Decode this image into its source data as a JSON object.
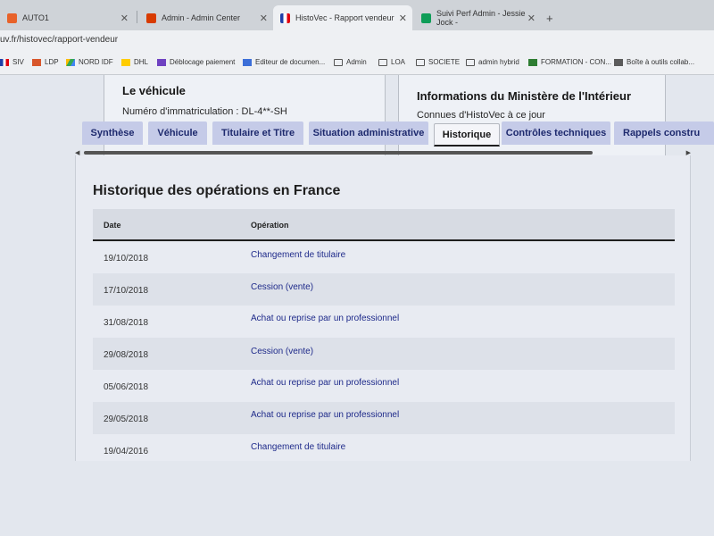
{
  "browser": {
    "tabs": [
      {
        "title": "AUTO1",
        "favicon_color": "#e8622a",
        "active": false
      },
      {
        "title": "Admin - Admin Center",
        "favicon_color": "#d83b01",
        "active": false
      },
      {
        "title": "HistoVec - Rapport vendeur",
        "favicon_color": "#3a4db0",
        "active": true
      },
      {
        "title": "Suivi Perf Admin - Jessie Jock -",
        "favicon_color": "#0f9d58",
        "active": false
      }
    ],
    "new_tab": "+",
    "url": "uv.fr/histovec/rapport-vendeur"
  },
  "bookmarks": [
    {
      "label": "SIV",
      "icon": "flag-icon"
    },
    {
      "label": "LDP",
      "icon": "app-icon"
    },
    {
      "label": "NORD IDF",
      "icon": "drive-icon"
    },
    {
      "label": "DHL",
      "icon": "dhl-icon"
    },
    {
      "label": "Déblocage paiement",
      "icon": "app-icon"
    },
    {
      "label": "Editeur de documen...",
      "icon": "doc-icon"
    },
    {
      "label": "Admin",
      "icon": "folder-icon"
    },
    {
      "label": "LOA",
      "icon": "folder-icon"
    },
    {
      "label": "SOCIETE",
      "icon": "folder-icon"
    },
    {
      "label": "admin hybrid",
      "icon": "folder-icon"
    },
    {
      "label": "FORMATION - CON...",
      "icon": "app-icon"
    },
    {
      "label": "Boîte à outils collab...",
      "icon": "app-icon"
    }
  ],
  "vehicle_card": {
    "title": "Le véhicule",
    "plate_label": "Numéro d'immatriculation : DL-4**-SH"
  },
  "ministry_card": {
    "title": "Informations du Ministère de l'Intérieur",
    "subtitle": "Connues d'HistoVec à ce jour"
  },
  "page_tabs": [
    {
      "label": "Synthèse",
      "active": false
    },
    {
      "label": "Véhicule",
      "active": false
    },
    {
      "label": "Titulaire et Titre",
      "active": false
    },
    {
      "label": "Situation administrative",
      "active": false
    },
    {
      "label": "Historique",
      "active": true
    },
    {
      "label": "Contrôles techniques",
      "active": false
    },
    {
      "label": "Rappels constru",
      "active": false
    }
  ],
  "history": {
    "title": "Historique des opérations en France",
    "columns": [
      "Date",
      "Opération"
    ],
    "rows": [
      {
        "date": "19/10/2018",
        "operation": "Changement de titulaire"
      },
      {
        "date": "17/10/2018",
        "operation": "Cession (vente)"
      },
      {
        "date": "31/08/2018",
        "operation": "Achat ou reprise par un professionnel"
      },
      {
        "date": "29/08/2018",
        "operation": "Cession (vente)"
      },
      {
        "date": "05/06/2018",
        "operation": "Achat ou reprise par un professionnel"
      },
      {
        "date": "29/05/2018",
        "operation": "Achat ou reprise par un professionnel"
      },
      {
        "date": "19/04/2016",
        "operation": "Changement de titulaire"
      }
    ]
  }
}
